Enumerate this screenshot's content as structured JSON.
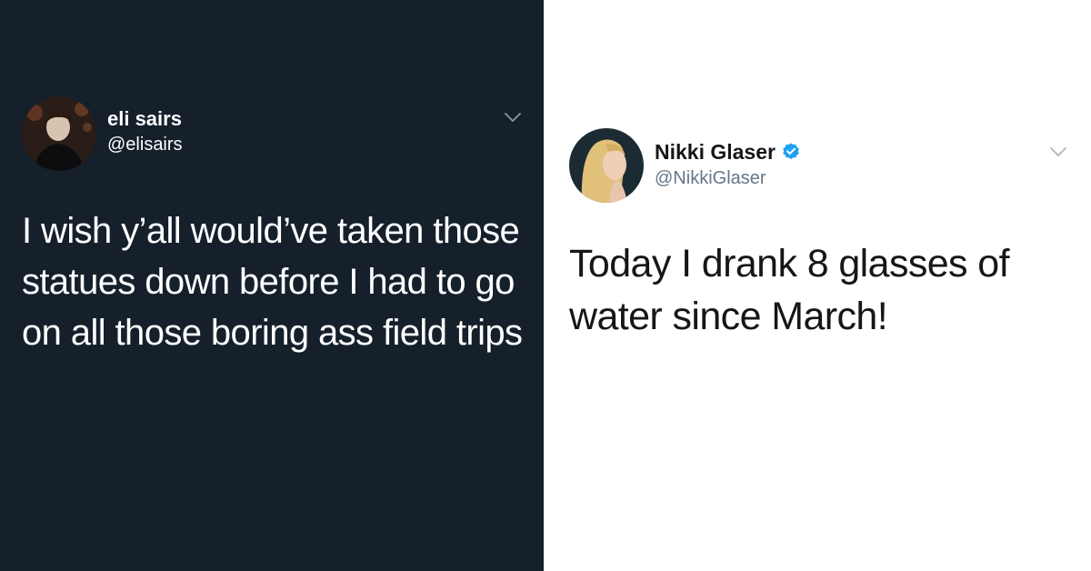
{
  "tweets": [
    {
      "theme": "dark",
      "display_name": "eli sairs",
      "handle": "@elisairs",
      "verified": false,
      "text": "I wish y’all would’ve taken those statues down before I had to go on all those boring ass field trips",
      "avatar_icon": "profile-photo",
      "menu_icon": "chevron-down-icon",
      "colors": {
        "background": "#15202b",
        "text": "#ffffff",
        "secondary": "#ffffff"
      }
    },
    {
      "theme": "light",
      "display_name": "Nikki Glaser",
      "handle": "@NikkiGlaser",
      "verified": true,
      "text": "Today I drank 8 glasses of water since March!",
      "avatar_icon": "profile-photo",
      "menu_icon": "chevron-down-icon",
      "badge_icon": "verified-badge-icon",
      "colors": {
        "background": "#ffffff",
        "text": "#14171a",
        "secondary": "#657786",
        "verified": "#1da1f2"
      }
    }
  ]
}
